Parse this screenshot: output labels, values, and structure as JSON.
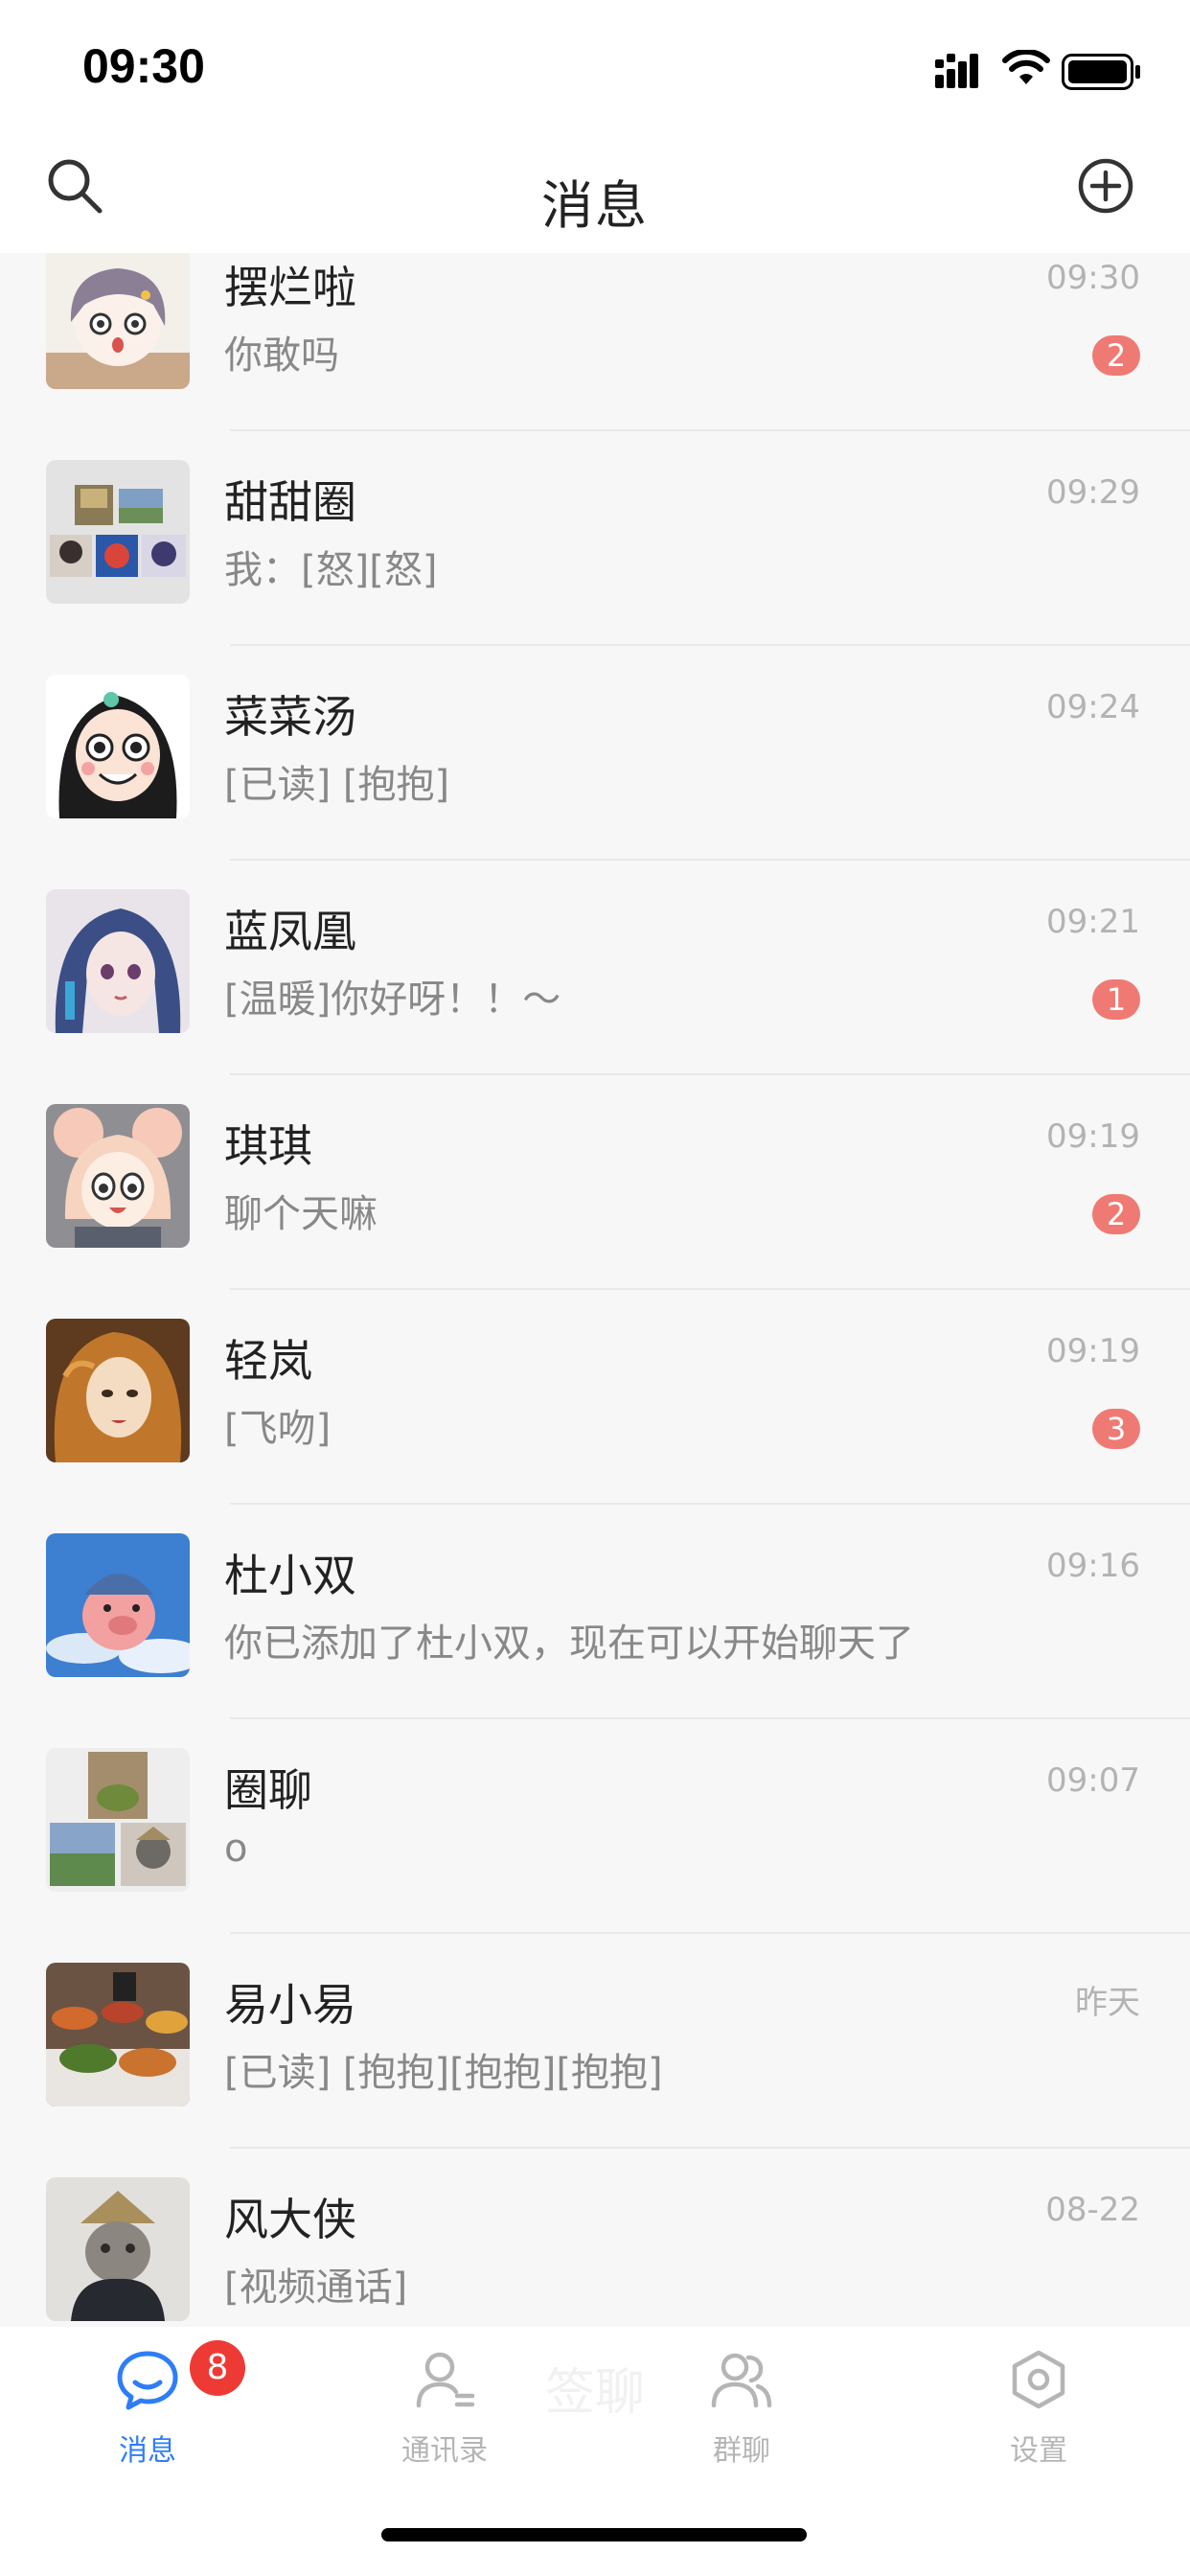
{
  "status_bar": {
    "time": "09:30"
  },
  "header": {
    "title": "消息"
  },
  "conversations": [
    {
      "name": "摆烂啦",
      "preview": "你敢吗",
      "time": "09:30",
      "unread": "2"
    },
    {
      "name": "甜甜圈",
      "preview": "我：[怒][怒]",
      "time": "09:29",
      "unread": ""
    },
    {
      "name": "菜菜汤",
      "preview": "[已读] [抱抱]",
      "time": "09:24",
      "unread": ""
    },
    {
      "name": "蓝凤凰",
      "preview": "[温暖]你好呀！！～",
      "time": "09:21",
      "unread": "1"
    },
    {
      "name": "琪琪",
      "preview": "聊个天嘛",
      "time": "09:19",
      "unread": "2"
    },
    {
      "name": "轻岚",
      "preview": "[飞吻]",
      "time": "09:19",
      "unread": "3"
    },
    {
      "name": "杜小双",
      "preview": "你已添加了杜小双，现在可以开始聊天了",
      "time": "09:16",
      "unread": ""
    },
    {
      "name": "圈聊",
      "preview": "o",
      "time": "09:07",
      "unread": ""
    },
    {
      "name": "易小易",
      "preview": "[已读] [抱抱][抱抱][抱抱]",
      "time": "昨天",
      "unread": ""
    },
    {
      "name": "风大侠",
      "preview": "[视频通话]",
      "time": "08-22",
      "unread": ""
    }
  ],
  "tab_bar": {
    "ghost_text": "签聊",
    "tabs": [
      {
        "label": "消息",
        "badge": "8",
        "icon": "chat-bubble-icon"
      },
      {
        "label": "通讯录",
        "icon": "contacts-icon"
      },
      {
        "label": "群聊",
        "icon": "group-icon"
      },
      {
        "label": "设置",
        "icon": "settings-icon"
      }
    ]
  },
  "colors": {
    "accent": "#2f7df6",
    "badge_red": "#ee3a35",
    "unread_badge": "#ef7a74",
    "inactive_tab": "#b5b5b5",
    "background": "#f7f7f7"
  }
}
